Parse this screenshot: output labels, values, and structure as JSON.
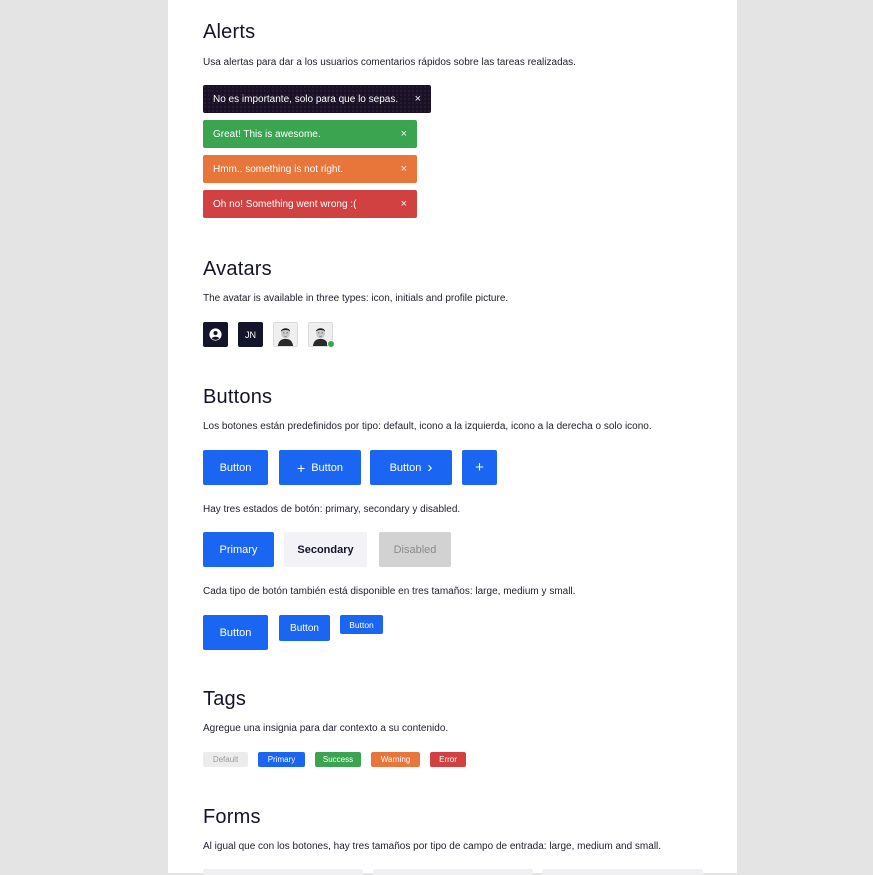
{
  "alerts": {
    "title": "Alerts",
    "description": "Usa alertas para dar a los usuarios comentarios rápidos sobre las tareas realizadas.",
    "items": [
      {
        "text": "No es importante, solo para que lo sepas.",
        "close": "×",
        "variant": "dark",
        "color": "#1b1127"
      },
      {
        "text": "Great! This is awesome.",
        "close": "×",
        "variant": "success",
        "color": "#3ba450"
      },
      {
        "text": "Hmm.. something is not right.",
        "close": "×",
        "variant": "warning",
        "color": "#e8753a"
      },
      {
        "text": "Oh no! Something went wrong :(",
        "close": "×",
        "variant": "error",
        "color": "#d14141"
      }
    ]
  },
  "avatars": {
    "title": "Avatars",
    "description": "The avatar is available in three types: icon, initials and profile picture.",
    "items": [
      {
        "type": "icon",
        "icon": "user-circle-icon"
      },
      {
        "type": "initials",
        "text": "JN"
      },
      {
        "type": "photo"
      },
      {
        "type": "photo-online",
        "status_color": "#3ba450"
      }
    ]
  },
  "buttons": {
    "title": "Buttons",
    "types_description": "Los botones están predefinidos por tipo: default, icono a la izquierda, icono a la derecha o solo icono.",
    "types": [
      {
        "label": "Button"
      },
      {
        "label": "Button",
        "icon_left": "+"
      },
      {
        "label": "Button",
        "icon_right": "›"
      },
      {
        "icon_only": "+"
      }
    ],
    "states_description": "Hay tres estados de botón: primary, secondary y disabled.",
    "states": [
      {
        "label": "Primary"
      },
      {
        "label": "Secondary"
      },
      {
        "label": "Disabled"
      }
    ],
    "sizes_description": "Cada tipo de botón también está disponible en tres tamaños: large, medium y small.",
    "sizes": [
      {
        "label": "Button",
        "size": "large"
      },
      {
        "label": "Button",
        "size": "medium"
      },
      {
        "label": "Button",
        "size": "small"
      }
    ],
    "primary_color": "#1a66f2"
  },
  "tags": {
    "title": "Tags",
    "description": "Agregue una insignia para dar contexto a su contenido.",
    "items": [
      {
        "label": "Default"
      },
      {
        "label": "Primary"
      },
      {
        "label": "Success"
      },
      {
        "label": "Warning"
      },
      {
        "label": "Error"
      }
    ]
  },
  "forms": {
    "title": "Forms",
    "description": "Al igual que con los botones, hay tres tamaños por tipo de campo de entrada: large, medium and small."
  }
}
